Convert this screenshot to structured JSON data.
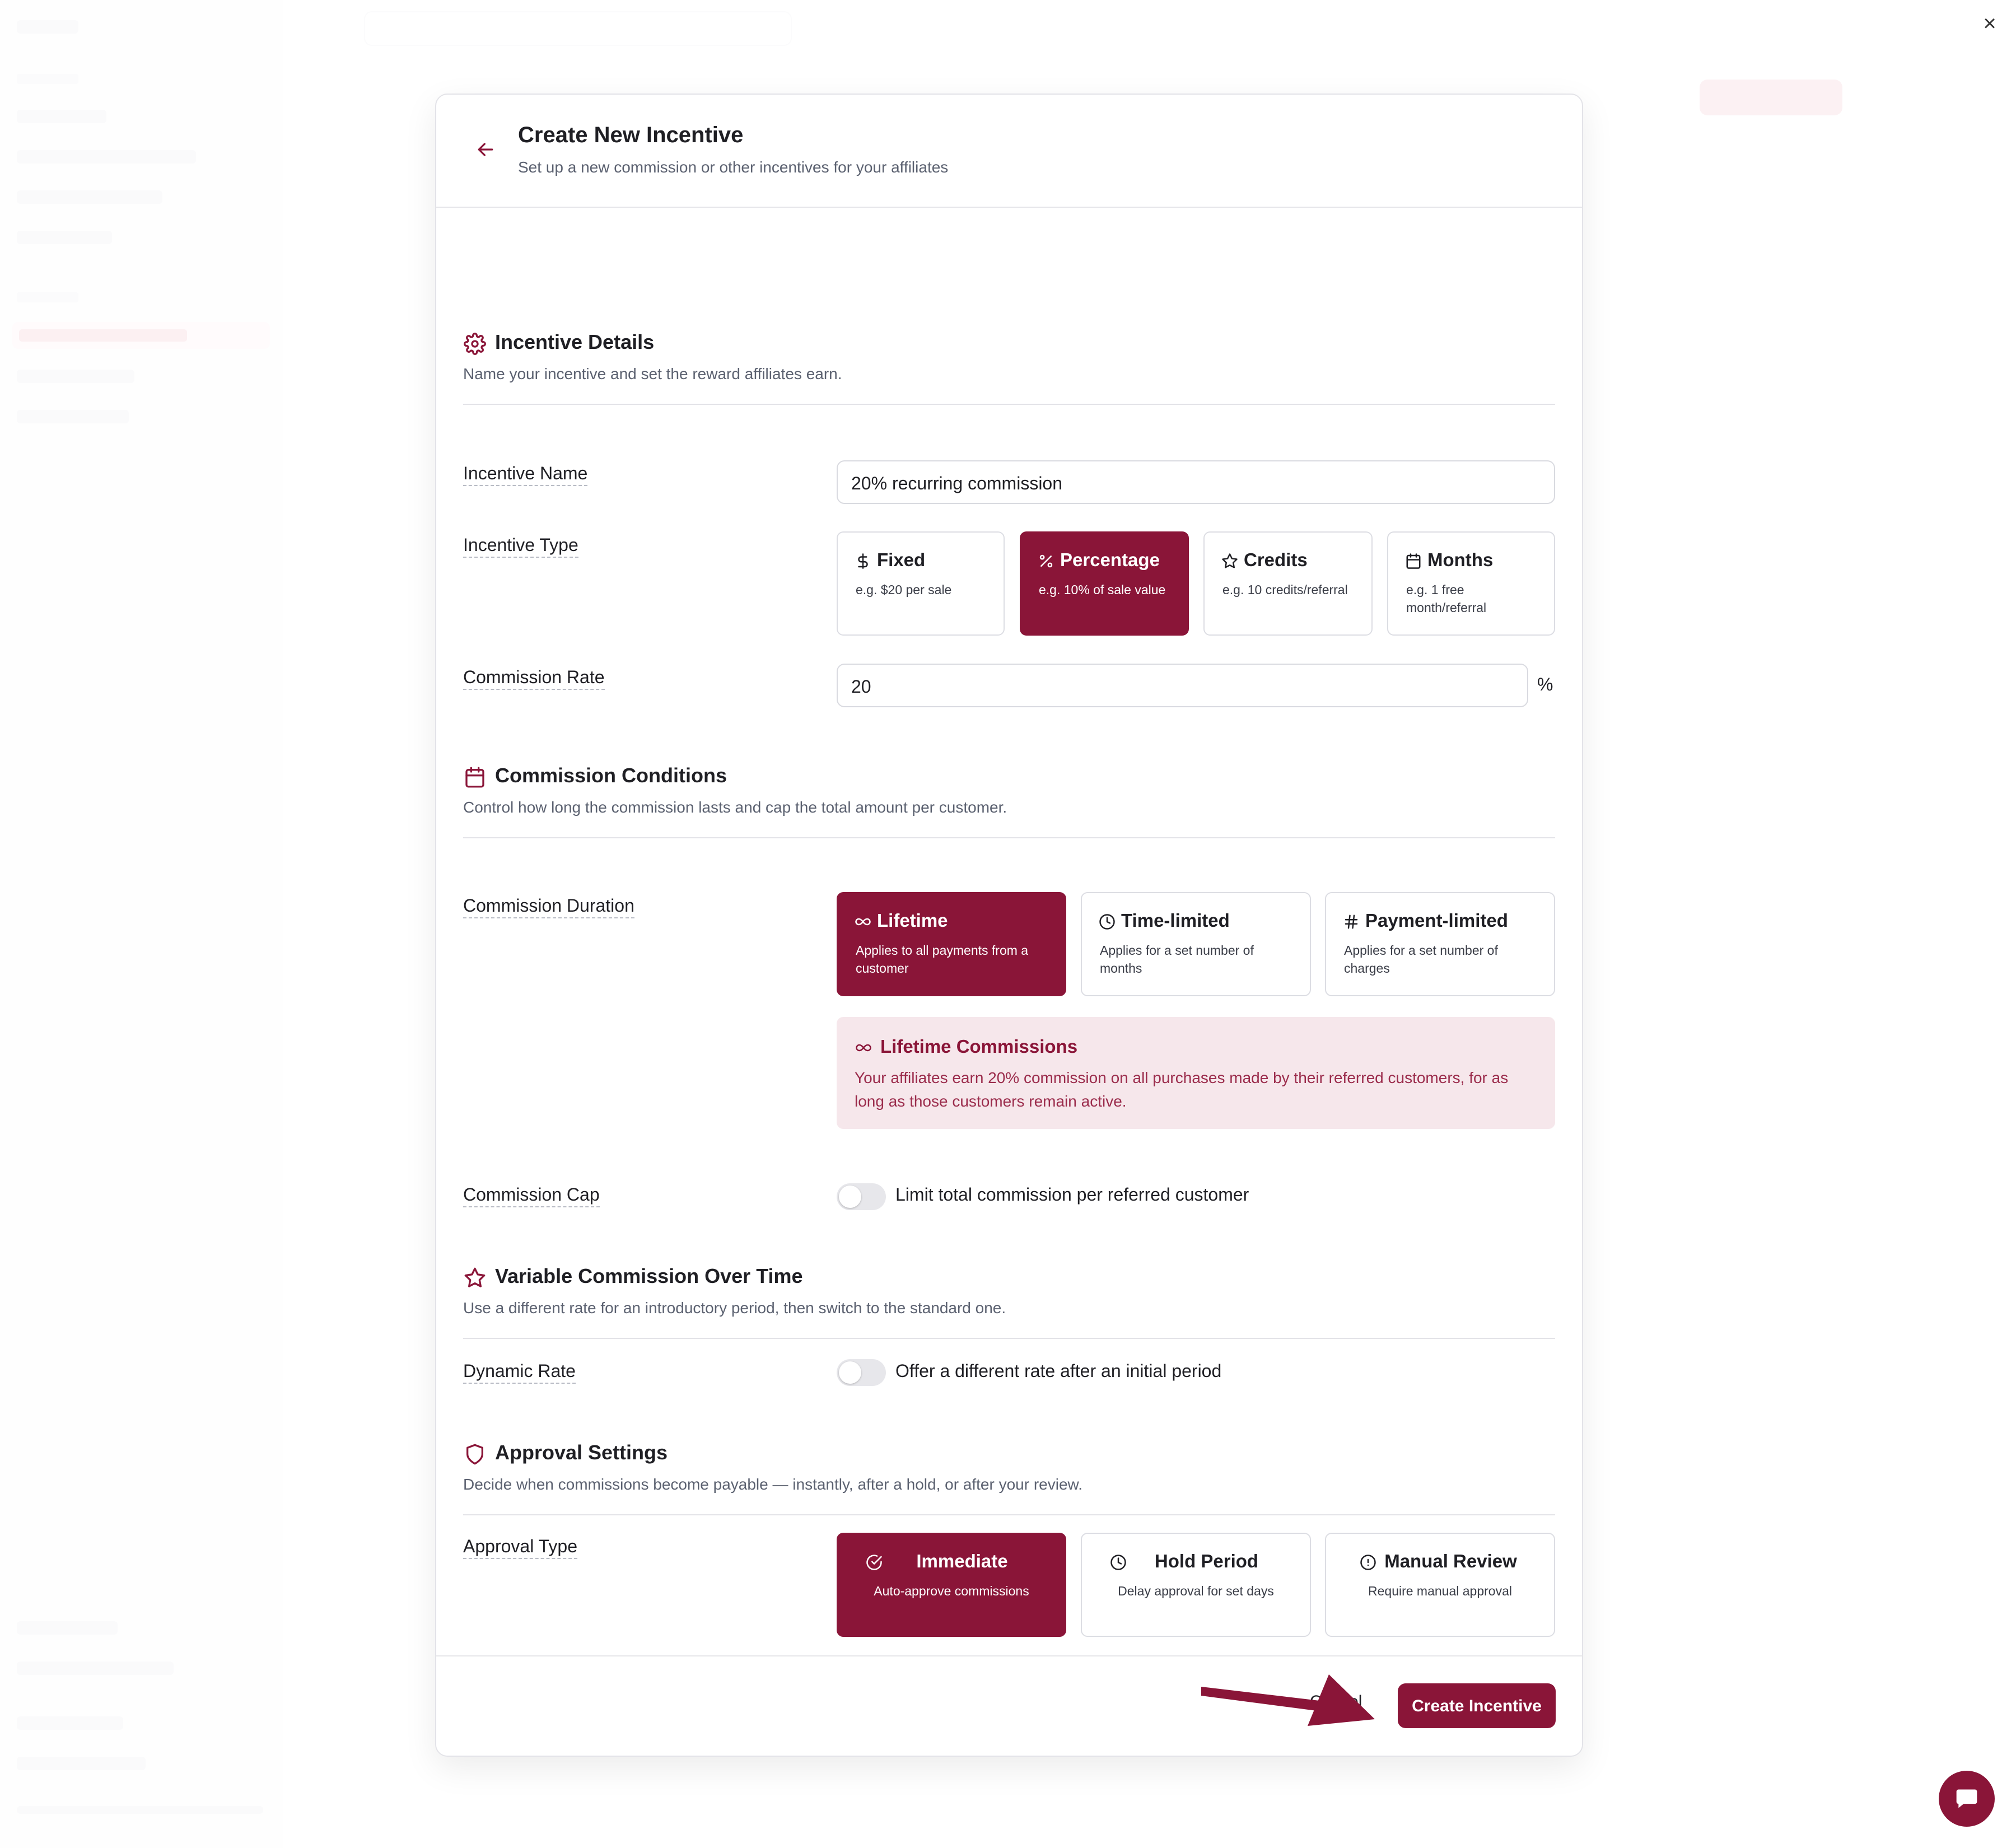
{
  "modal": {
    "title": "Create New Incentive",
    "subtitle": "Set up a new commission or other incentives for your affiliates"
  },
  "sections": {
    "details": {
      "title": "Incentive Details",
      "subtitle": "Name your incentive and set the reward affiliates earn."
    },
    "conditions": {
      "title": "Commission Conditions",
      "subtitle": "Control how long the commission lasts and cap the total amount per customer."
    },
    "variable": {
      "title": "Variable Commission Over Time",
      "subtitle": "Use a different rate for an introductory period, then switch to the standard one."
    },
    "approval": {
      "title": "Approval Settings",
      "subtitle": "Decide when commissions become payable — instantly, after a hold, or after your review."
    }
  },
  "fields": {
    "incentive_name": {
      "label": "Incentive Name",
      "value": "20% recurring commission"
    },
    "incentive_type": {
      "label": "Incentive Type",
      "selected": "Percentage",
      "options": [
        {
          "title": "Fixed",
          "desc": "e.g. $20 per sale",
          "icon": "dollar-icon"
        },
        {
          "title": "Percentage",
          "desc": "e.g. 10% of sale value",
          "icon": "percent-icon"
        },
        {
          "title": "Credits",
          "desc": "e.g. 10 credits/referral",
          "icon": "star-icon"
        },
        {
          "title": "Months",
          "desc": "e.g. 1 free month/referral",
          "icon": "calendar-icon"
        }
      ]
    },
    "commission_rate": {
      "label": "Commission Rate",
      "value": "20",
      "unit": "%"
    },
    "commission_duration": {
      "label": "Commission Duration",
      "selected": "Lifetime",
      "options": [
        {
          "title": "Lifetime",
          "desc": "Applies to all payments from a customer",
          "icon": "infinity-icon"
        },
        {
          "title": "Time-limited",
          "desc": "Applies for a set number of months",
          "icon": "clock-icon"
        },
        {
          "title": "Payment-limited",
          "desc": "Applies for a set number of charges",
          "icon": "hash-icon"
        }
      ]
    },
    "lifetime_info": {
      "title": "Lifetime Commissions",
      "text": "Your affiliates earn 20% commission on all purchases made by their referred customers, for as long as those customers remain active."
    },
    "commission_cap": {
      "label": "Commission Cap",
      "toggle_label": "Limit total commission per referred customer",
      "on": false
    },
    "dynamic_rate": {
      "label": "Dynamic Rate",
      "toggle_label": "Offer a different rate after an initial period",
      "on": false
    },
    "approval_type": {
      "label": "Approval Type",
      "selected": "Immediate",
      "options": [
        {
          "title": "Immediate",
          "desc": "Auto-approve commissions",
          "icon": "check-circle-icon"
        },
        {
          "title": "Hold Period",
          "desc": "Delay approval for set days",
          "icon": "clock-icon"
        },
        {
          "title": "Manual Review",
          "desc": "Require manual approval",
          "icon": "alert-circle-icon"
        }
      ]
    }
  },
  "footer": {
    "cancel_label": "Cancel",
    "create_label": "Create Incentive"
  },
  "colors": {
    "accent": "#8a1538",
    "accent_light": "#f6e7eb"
  }
}
